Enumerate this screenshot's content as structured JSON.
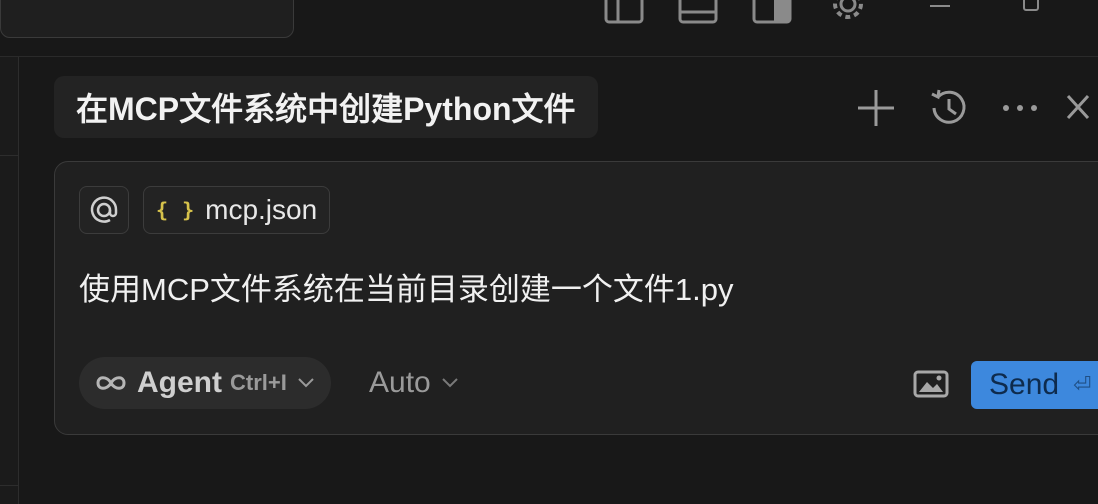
{
  "chat": {
    "title": "在MCP文件系统中创建Python文件",
    "actions": [
      {
        "name": "new-chat",
        "icon": "plus-icon"
      },
      {
        "name": "history",
        "icon": "history-icon"
      },
      {
        "name": "more",
        "icon": "more-icon"
      },
      {
        "name": "close",
        "icon": "close-icon"
      }
    ]
  },
  "composer": {
    "context_chip_icon": "at-icon",
    "file_chip": {
      "icon": "json-braces-icon",
      "braces": "{ }",
      "label": "mcp.json"
    },
    "prompt": "使用MCP文件系统在当前目录创建一个文件1.py",
    "mode": {
      "icon": "infinity-icon",
      "label": "Agent",
      "shortcut": "Ctrl+I"
    },
    "model": {
      "label": "Auto"
    },
    "send": {
      "label": "Send",
      "glyph": "⏎"
    }
  },
  "colors": {
    "background": "#181818",
    "panel": "#202020",
    "accent": "#3d88dd",
    "json_icon": "#d6c24b"
  }
}
